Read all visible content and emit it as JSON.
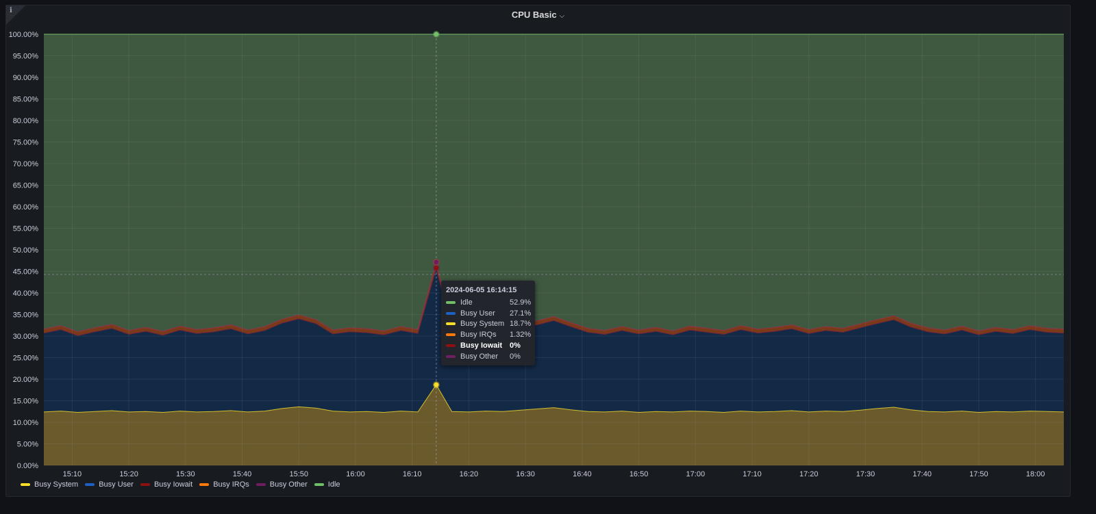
{
  "panel": {
    "title": "CPU Basic",
    "info_icon": "info-icon",
    "menu_icon": "chevron-down-icon"
  },
  "chart_data": {
    "type": "area",
    "stacked": true,
    "title": "CPU Basic",
    "xlabel": "",
    "ylabel": "",
    "ylim": [
      0,
      100
    ],
    "y_unit": "%",
    "y_ticks": [
      "0.00%",
      "5.00%",
      "10.00%",
      "15.00%",
      "20.00%",
      "25.00%",
      "30.00%",
      "35.00%",
      "40.00%",
      "45.00%",
      "50.00%",
      "55.00%",
      "60.00%",
      "65.00%",
      "70.00%",
      "75.00%",
      "80.00%",
      "85.00%",
      "90.00%",
      "95.00%",
      "100.00%"
    ],
    "x_ticks": [
      "15:10",
      "15:20",
      "15:30",
      "15:40",
      "15:50",
      "16:00",
      "16:10",
      "16:20",
      "16:30",
      "16:40",
      "16:50",
      "17:00",
      "17:10",
      "17:20",
      "17:30",
      "17:40",
      "17:50",
      "18:00"
    ],
    "xlim": [
      "15:05",
      "18:05"
    ],
    "grid": true,
    "legend_position": "bottom-left",
    "x": [
      "15:05",
      "15:08",
      "15:11",
      "15:14",
      "15:17",
      "15:20",
      "15:23",
      "15:26",
      "15:29",
      "15:32",
      "15:35",
      "15:38",
      "15:41",
      "15:44",
      "15:47",
      "15:50",
      "15:53",
      "15:56",
      "15:59",
      "16:02",
      "16:05",
      "16:08",
      "16:11",
      "16:14:15",
      "16:17",
      "16:20",
      "16:23",
      "16:26",
      "16:29",
      "16:32",
      "16:35",
      "16:38",
      "16:41",
      "16:44",
      "16:47",
      "16:50",
      "16:53",
      "16:56",
      "16:59",
      "17:02",
      "17:05",
      "17:08",
      "17:11",
      "17:14",
      "17:17",
      "17:20",
      "17:23",
      "17:26",
      "17:29",
      "17:32",
      "17:35",
      "17:38",
      "17:41",
      "17:44",
      "17:47",
      "17:50",
      "17:53",
      "17:56",
      "17:59",
      "18:02",
      "18:05"
    ],
    "series": [
      {
        "name": "Busy System",
        "color": "#fade2a",
        "values": [
          12.4,
          12.6,
          12.3,
          12.5,
          12.7,
          12.4,
          12.5,
          12.3,
          12.6,
          12.4,
          12.5,
          12.7,
          12.4,
          12.6,
          13.2,
          13.6,
          13.3,
          12.6,
          12.4,
          12.5,
          12.3,
          12.6,
          12.4,
          18.7,
          12.5,
          12.4,
          12.6,
          12.5,
          12.8,
          13.1,
          13.4,
          12.9,
          12.5,
          12.4,
          12.6,
          12.3,
          12.5,
          12.4,
          12.6,
          12.5,
          12.3,
          12.6,
          12.4,
          12.5,
          12.7,
          12.4,
          12.6,
          12.5,
          12.8,
          13.2,
          13.5,
          12.9,
          12.5,
          12.4,
          12.6,
          12.3,
          12.5,
          12.4,
          12.6,
          12.5,
          12.4
        ]
      },
      {
        "name": "Busy User",
        "color": "#1f60c4",
        "values": [
          18.3,
          18.9,
          17.8,
          18.5,
          19.1,
          18.0,
          18.6,
          17.9,
          18.8,
          18.2,
          18.5,
          19.0,
          18.1,
          18.7,
          19.8,
          20.4,
          19.6,
          17.9,
          18.6,
          18.3,
          18.0,
          18.7,
          18.2,
          27.1,
          18.4,
          18.1,
          18.8,
          18.3,
          19.0,
          19.5,
          20.2,
          19.3,
          18.4,
          18.0,
          18.7,
          18.2,
          18.6,
          17.9,
          18.8,
          18.4,
          18.1,
          18.9,
          18.3,
          18.6,
          19.0,
          18.2,
          18.7,
          18.4,
          19.1,
          19.7,
          20.3,
          19.2,
          18.5,
          18.1,
          18.8,
          18.0,
          18.6,
          18.2,
          18.9,
          18.4,
          18.3
        ]
      },
      {
        "name": "Busy Iowait",
        "color": "#8f1010",
        "values": [
          0,
          0,
          0,
          0,
          0,
          0,
          0,
          0,
          0,
          0,
          0,
          0,
          0,
          0,
          0,
          0,
          0,
          0,
          0,
          0,
          0,
          0,
          0,
          0,
          0,
          0,
          0,
          0,
          0,
          0,
          0,
          0,
          0,
          0,
          0,
          0,
          0,
          0,
          0,
          0,
          0,
          0,
          0,
          0,
          0,
          0,
          0,
          0,
          0,
          0,
          0,
          0,
          0,
          0,
          0,
          0,
          0,
          0,
          0,
          0,
          0
        ]
      },
      {
        "name": "Busy IRQs",
        "color": "#ff780a",
        "values": [
          0.9,
          0.9,
          0.9,
          0.9,
          0.9,
          0.9,
          0.9,
          0.9,
          0.9,
          0.9,
          0.9,
          0.9,
          0.9,
          0.9,
          0.9,
          0.9,
          0.9,
          0.9,
          0.9,
          0.9,
          0.9,
          0.9,
          0.9,
          1.32,
          0.9,
          0.9,
          0.9,
          0.9,
          0.9,
          0.9,
          0.9,
          0.9,
          0.9,
          0.9,
          0.9,
          0.9,
          0.9,
          0.9,
          0.9,
          0.9,
          0.9,
          0.9,
          0.9,
          0.9,
          0.9,
          0.9,
          0.9,
          0.9,
          0.9,
          0.9,
          0.9,
          0.9,
          0.9,
          0.9,
          0.9,
          0.9,
          0.9,
          0.9,
          0.9,
          0.9,
          0.9
        ]
      },
      {
        "name": "Busy Other",
        "color": "#6d1f62",
        "values": [
          0,
          0,
          0,
          0,
          0,
          0,
          0,
          0,
          0,
          0,
          0,
          0,
          0,
          0,
          0,
          0,
          0,
          0,
          0,
          0,
          0,
          0,
          0,
          0,
          0,
          0,
          0,
          0,
          0,
          0,
          0,
          0,
          0,
          0,
          0,
          0,
          0,
          0,
          0,
          0,
          0,
          0,
          0,
          0,
          0,
          0,
          0,
          0,
          0,
          0,
          0,
          0,
          0,
          0,
          0,
          0,
          0,
          0,
          0,
          0,
          0
        ]
      },
      {
        "name": "Idle",
        "color": "#73bf69",
        "values": "remainder to 100%"
      }
    ]
  },
  "legend": [
    {
      "label": "Busy System",
      "color": "#fade2a"
    },
    {
      "label": "Busy User",
      "color": "#1f60c4"
    },
    {
      "label": "Busy Iowait",
      "color": "#8f1010"
    },
    {
      "label": "Busy IRQs",
      "color": "#ff780a"
    },
    {
      "label": "Busy Other",
      "color": "#6d1f62"
    },
    {
      "label": "Idle",
      "color": "#73bf69"
    }
  ],
  "tooltip": {
    "time": "2024-06-05 16:14:15",
    "rows": [
      {
        "label": "Idle",
        "value": "52.9%",
        "color": "#73bf69"
      },
      {
        "label": "Busy User",
        "value": "27.1%",
        "color": "#1f60c4"
      },
      {
        "label": "Busy System",
        "value": "18.7%",
        "color": "#fade2a"
      },
      {
        "label": "Busy IRQs",
        "value": "1.32%",
        "color": "#ff780a"
      },
      {
        "label": "Busy Iowait",
        "value": "0%",
        "color": "#8f1010"
      },
      {
        "label": "Busy Other",
        "value": "0%",
        "color": "#6d1f62"
      }
    ]
  }
}
